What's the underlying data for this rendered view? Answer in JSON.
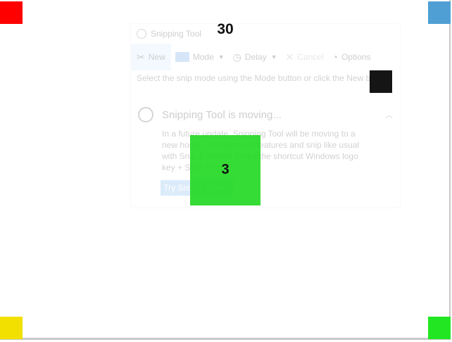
{
  "markers": {
    "top_label": "30",
    "center_label": "3",
    "colors": {
      "top_left": "#ff0000",
      "top_right": "#4f9fd4",
      "bottom_left": "#f2e000",
      "bottom_right": "#22e622",
      "dark_square": "#151515",
      "center_block": "#1fd81f"
    }
  },
  "window": {
    "title": "Snipping Tool",
    "app_icon": "scissors-icon",
    "toolbar": {
      "new_label": "New",
      "mode_label": "Mode",
      "delay_label": "Delay",
      "cancel_label": "Cancel",
      "options_label": "Options"
    },
    "hint": "Select the snip mode using the Mode button or click the New button.",
    "notice": {
      "title": "Snipping Tool is moving...",
      "body": "In a future update, Snipping Tool will be moving to a new home. Try improved features and snip like usual with Snip & Sketch (or try the shortcut Windows logo key + Shift + S).",
      "button_label": "Try Snip & Sketch"
    }
  }
}
